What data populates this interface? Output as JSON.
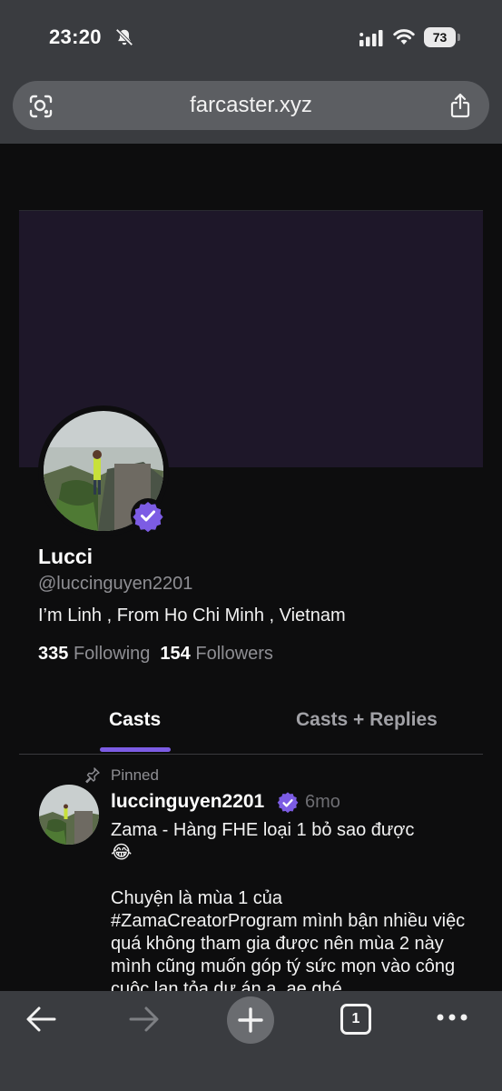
{
  "status_bar": {
    "time": "23:20",
    "battery": "73"
  },
  "browser": {
    "url": "farcaster.xyz",
    "tab_count": "1"
  },
  "profile": {
    "display_name": "Lucci",
    "handle": "@luccinguyen2201",
    "bio": "I’m Linh , From Ho Chi Minh , Vietnam",
    "following_count": "335",
    "following_label": "Following",
    "followers_count": "154",
    "followers_label": "Followers"
  },
  "tabs": [
    {
      "label": "Casts",
      "active": true
    },
    {
      "label": "Casts + Replies",
      "active": false
    }
  ],
  "pinned_post": {
    "pinned_label": "Pinned",
    "author": "luccinguyen2201",
    "time": "6mo",
    "text": "Zama - Hàng FHE loại 1 bỏ sao được\n😂\n\nChuyện là mùa 1 của\n#ZamaCreatorProgram mình bận nhiều việc quá không tham gia được nên mùa 2 này mình cũng muốn góp tý sức mọn vào công cuộc lan tỏa dự án a, ae ghé"
  },
  "colors": {
    "accent": "#7c5ce4",
    "cover": "#1e1729",
    "chrome": "#3a3c40",
    "background": "#0d0d0e"
  },
  "icons": [
    "bell-off-icon",
    "signal-icon",
    "wifi-icon",
    "battery-icon",
    "lens-icon",
    "share-icon",
    "verified-icon",
    "pin-icon",
    "back-arrow-icon",
    "forward-arrow-icon",
    "plus-icon",
    "tabs-icon",
    "more-icon"
  ]
}
